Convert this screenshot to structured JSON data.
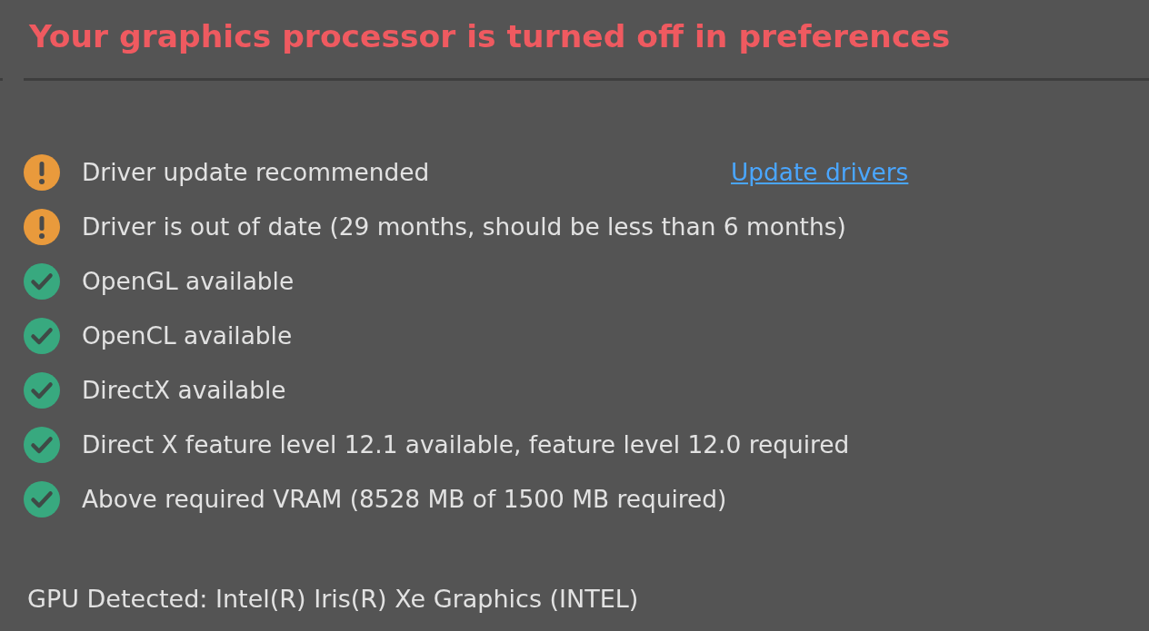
{
  "title": "Your graphics processor is turned off in preferences",
  "checks": [
    {
      "kind": "warning",
      "text": "Driver update recommended",
      "link": "Update drivers"
    },
    {
      "kind": "warning",
      "text": "Driver is out of date (29 months, should be less than 6 months)"
    },
    {
      "kind": "ok",
      "text": "OpenGL available"
    },
    {
      "kind": "ok",
      "text": "OpenCL available"
    },
    {
      "kind": "ok",
      "text": "DirectX available"
    },
    {
      "kind": "ok",
      "text": "Direct X feature level 12.1 available, feature level 12.0 required"
    },
    {
      "kind": "ok",
      "text": "Above required VRAM (8528 MB of 1500 MB required)"
    }
  ],
  "gpu_detected": "GPU Detected: Intel(R) Iris(R) Xe Graphics (INTEL)"
}
